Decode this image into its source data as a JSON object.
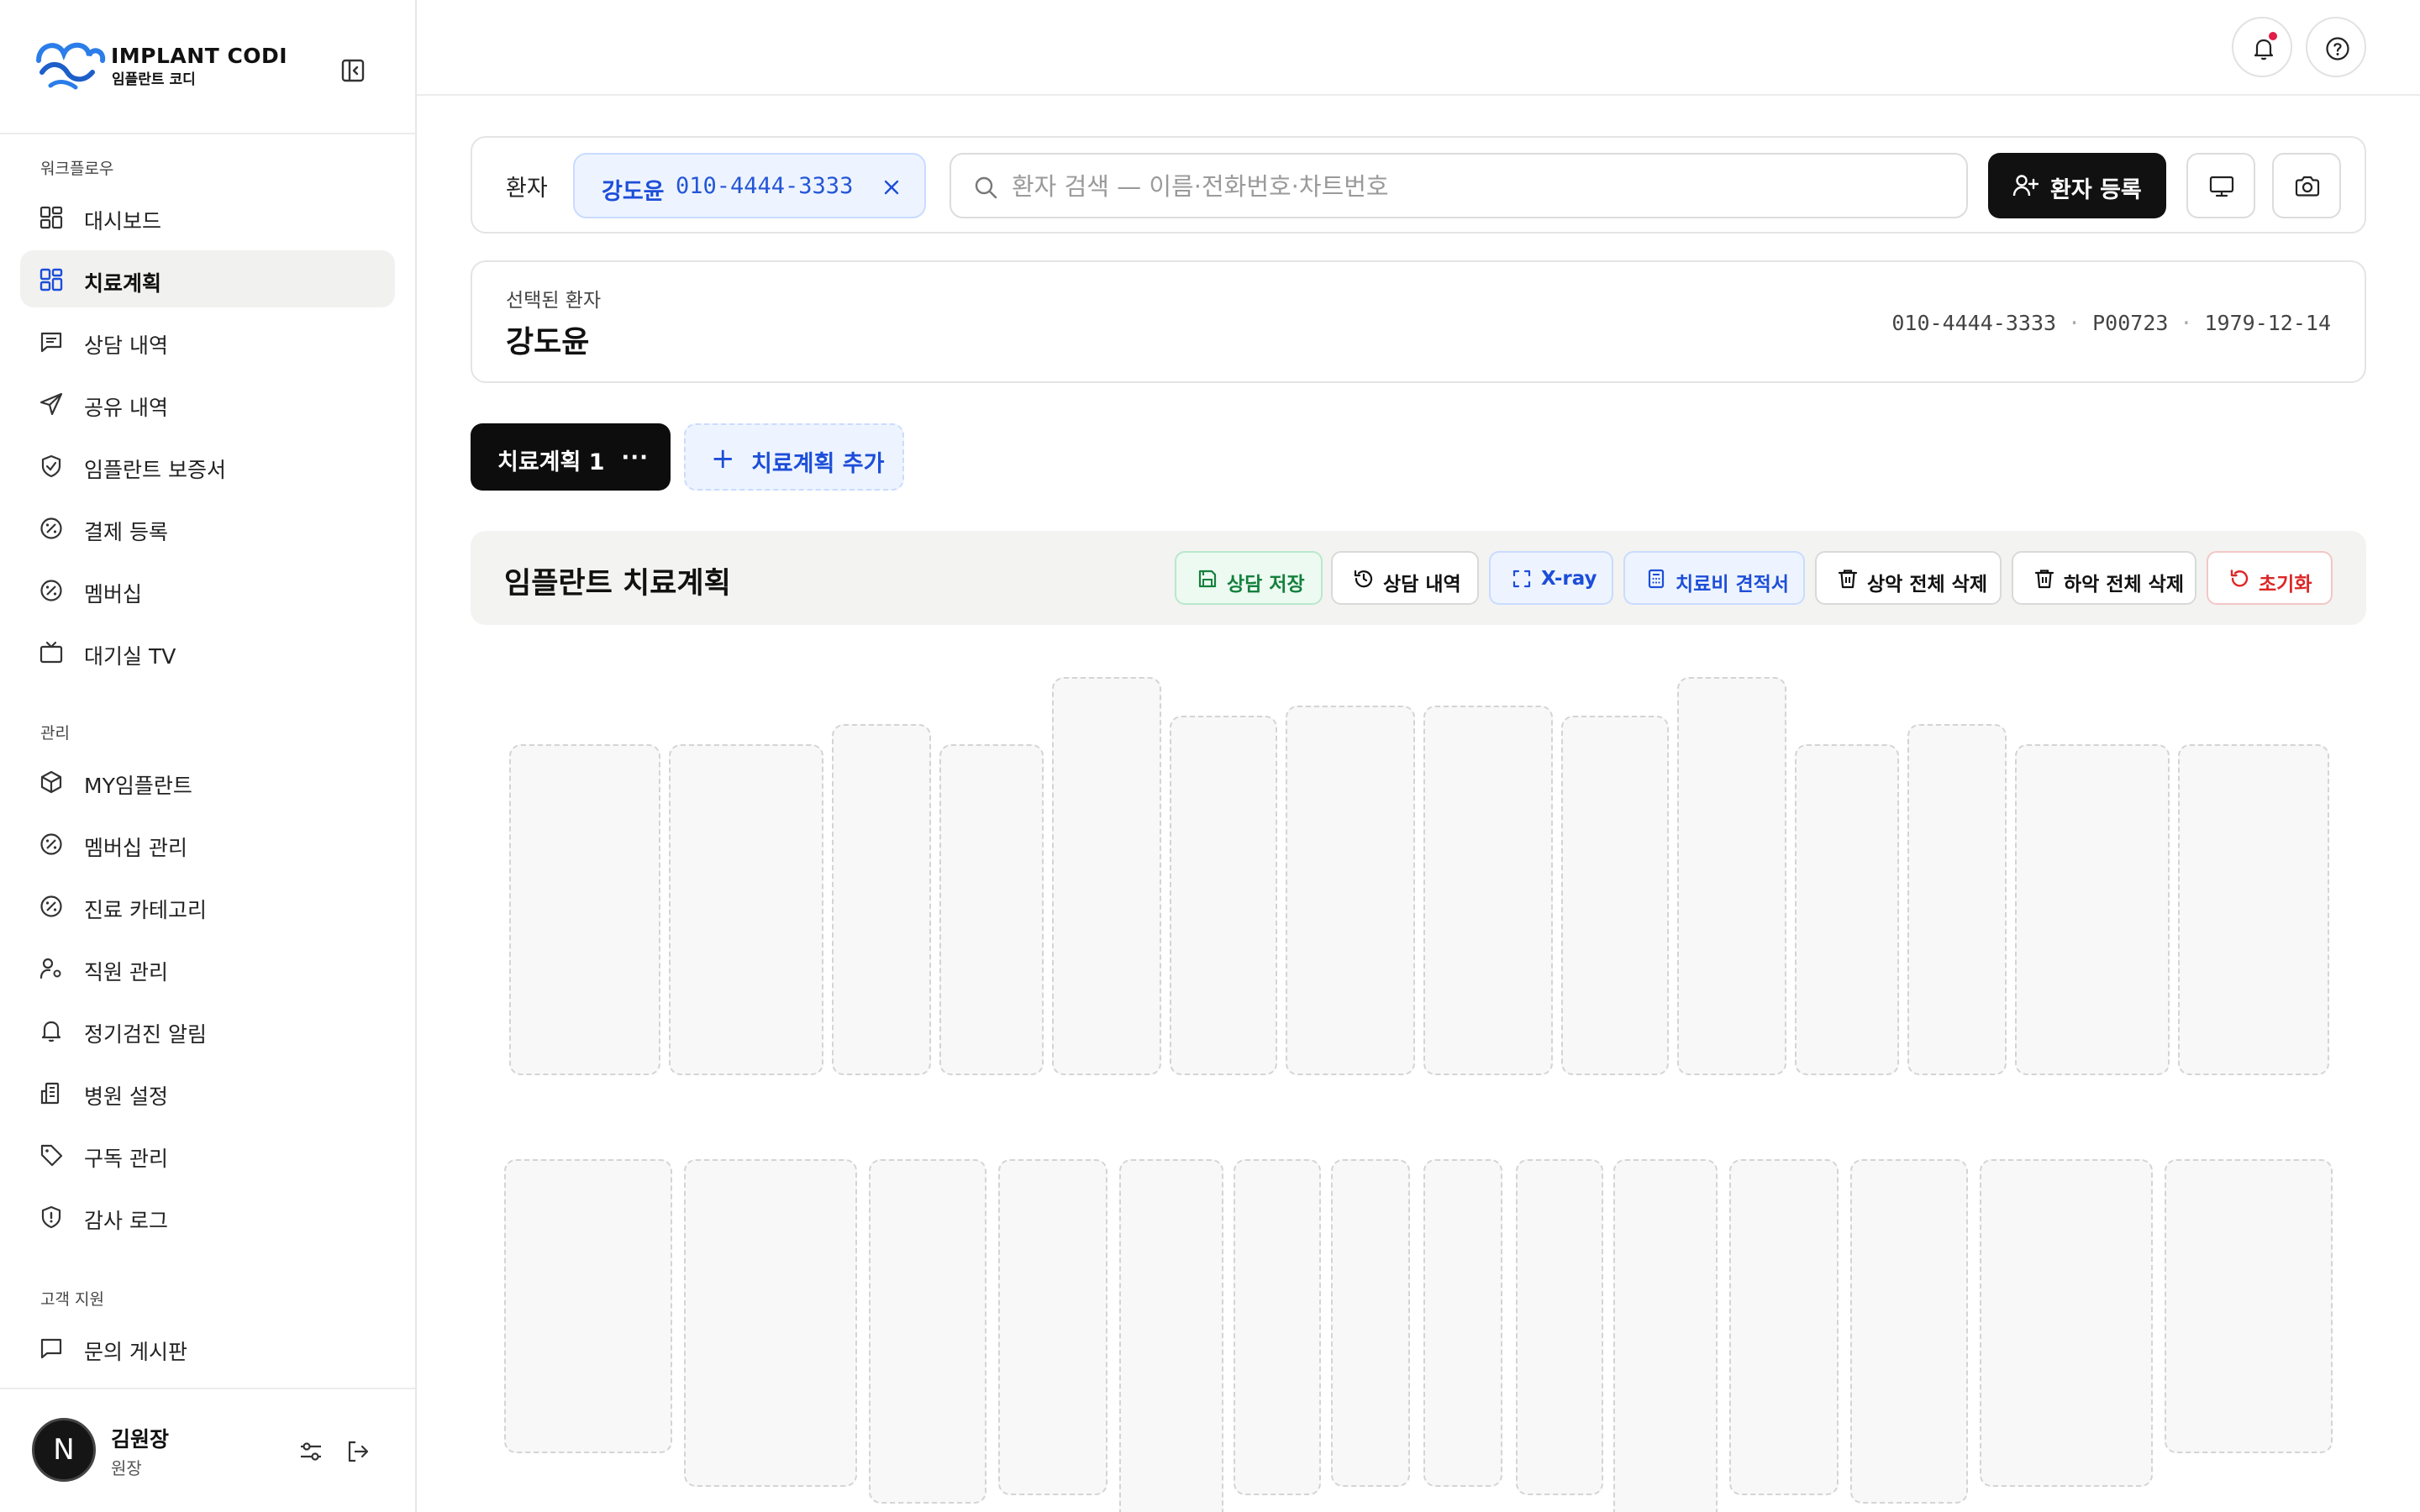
{
  "brand": {
    "title": "IMPLANT CODI",
    "subtitle": "임플란트 코디"
  },
  "sidebar": {
    "sections": [
      {
        "label": "워크플로우"
      },
      {
        "label": "관리"
      },
      {
        "label": "고객 지원"
      }
    ],
    "items": [
      {
        "label": "대시보드",
        "icon": "dashboard-icon"
      },
      {
        "label": "치료계획",
        "icon": "layout-grid-icon",
        "active": true
      },
      {
        "label": "상담 내역",
        "icon": "message-square-icon"
      },
      {
        "label": "공유 내역",
        "icon": "send-icon"
      },
      {
        "label": "임플란트 보증서",
        "icon": "shield-check-icon"
      },
      {
        "label": "결제 등록",
        "icon": "badge-percent-icon"
      },
      {
        "label": "멤버십",
        "icon": "badge-percent-icon"
      },
      {
        "label": "대기실 TV",
        "icon": "tv-icon"
      },
      {
        "label": "MY임플란트",
        "icon": "package-icon"
      },
      {
        "label": "멤버십 관리",
        "icon": "badge-percent-icon"
      },
      {
        "label": "진료 카테고리",
        "icon": "badge-percent-icon"
      },
      {
        "label": "직원 관리",
        "icon": "user-cog-icon"
      },
      {
        "label": "정기검진 알림",
        "icon": "bell-icon"
      },
      {
        "label": "병원 설정",
        "icon": "building-icon"
      },
      {
        "label": "구독 관리",
        "icon": "tag-icon"
      },
      {
        "label": "감사 로그",
        "icon": "shield-alert-icon"
      },
      {
        "label": "문의 게시판",
        "icon": "message-square-icon"
      }
    ]
  },
  "user": {
    "initial": "N",
    "name": "김원장",
    "role": "원장"
  },
  "patient_bar": {
    "label": "환자",
    "chip_name": "강도윤",
    "chip_phone": "010-4444-3333",
    "search_placeholder": "환자 검색 — 이름·전화번호·차트번호",
    "search_value": "",
    "register_label": "환자 등록"
  },
  "selected_patient": {
    "caption": "선택된 환자",
    "name": "강도윤",
    "phone": "010-4444-3333",
    "chart_no": "P00723",
    "birth": "1979-12-14"
  },
  "plan_tabs": {
    "active_label": "치료계획 1",
    "more": "···",
    "add_label": "치료계획 추가"
  },
  "plan_header": {
    "title": "임플란트 치료계획",
    "actions": {
      "save": "상담 저장",
      "history": "상담 내역",
      "xray": "X-ray",
      "estimate": "치료비 견적서",
      "delete_upper": "상악 전체 삭제",
      "delete_lower": "하악 전체 삭제",
      "reset": "초기화"
    }
  },
  "colors": {
    "accent_blue": "#1d4ed8",
    "save_green": "#15803d",
    "reset_red": "#dc2626",
    "notification_dot": "#e11d48",
    "primary_black": "#111111"
  }
}
